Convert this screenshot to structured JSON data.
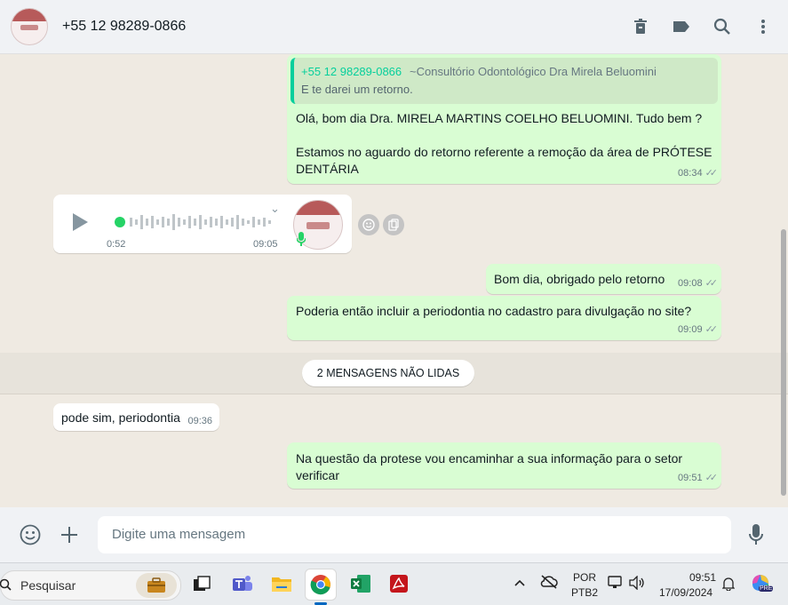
{
  "header": {
    "contact": "+55 12 98289-0866",
    "icons": [
      "trash-icon",
      "tag-icon",
      "search-icon",
      "more-icon"
    ]
  },
  "chat": {
    "msg1": {
      "quote_name": "+55 12 98289-0866",
      "quote_sub": "~Consultório Odontológico Dra Mirela Beluomini",
      "quote_text": "E te darei um retorno.",
      "line1": "Olá, bom dia Dra. MIRELA MARTINS COELHO BELUOMINI. Tudo bem ?",
      "line2": "Estamos no aguardo do retorno referente a remoção da área de PRÓTESE",
      "line3": "DENTÁRIA",
      "time": "08:34"
    },
    "audio": {
      "duration": "0:52",
      "time": "09:05"
    },
    "msg2": {
      "text": "Bom dia, obrigado pelo retorno",
      "time": "09:08"
    },
    "msg3": {
      "text": "Poderia então incluir a periodontia no cadastro para divulgação no site?",
      "time": "09:09"
    },
    "unread": "2 MENSAGENS NÃO LIDAS",
    "msg4": {
      "text": "pode sim, periodontia",
      "time": "09:36"
    },
    "msg5": {
      "line1": "Na questão da protese vou encaminhar a sua informação para o setor",
      "line2": "verificar",
      "time": "09:51"
    }
  },
  "compose": {
    "placeholder": "Digite uma mensagem"
  },
  "taskbar": {
    "search": "Pesquisar",
    "lang1": "POR",
    "lang2": "PTB2",
    "clock_time": "09:51",
    "clock_date": "17/09/2024",
    "pre": "PRE"
  },
  "colors": {
    "outgoing": "#d9fdd3",
    "incoming": "#ffffff",
    "accent": "#06cf9c",
    "background": "#efeae2"
  }
}
